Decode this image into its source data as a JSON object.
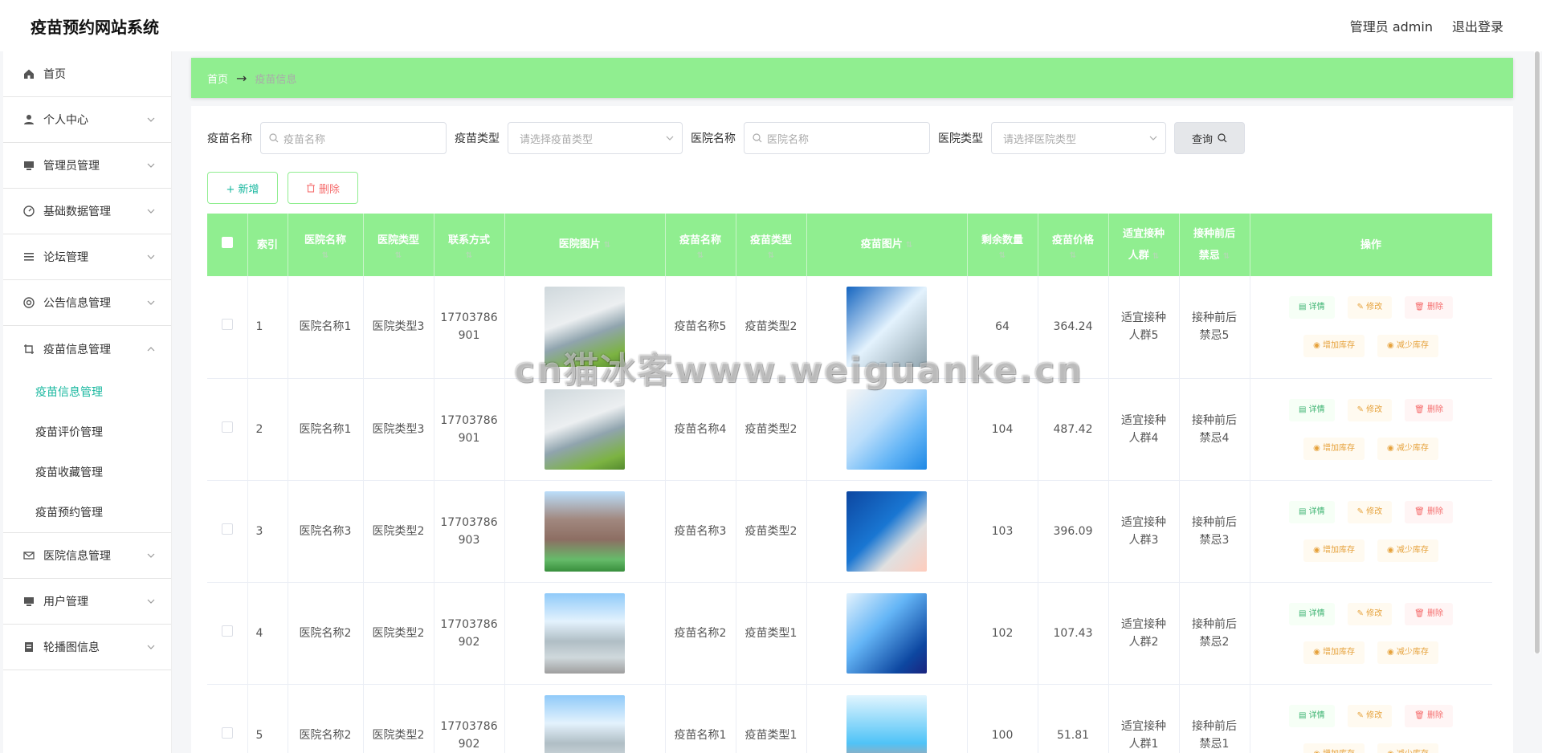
{
  "app": {
    "title": "疫苗预约网站系统",
    "user": "管理员 admin",
    "logout": "退出登录"
  },
  "sidebar": {
    "items": [
      {
        "label": "首页",
        "icon": "home-icon"
      },
      {
        "label": "个人中心",
        "icon": "user-icon"
      },
      {
        "label": "管理员管理",
        "icon": "monitor-icon"
      },
      {
        "label": "基础数据管理",
        "icon": "gauge-icon"
      },
      {
        "label": "论坛管理",
        "icon": "list-icon"
      },
      {
        "label": "公告信息管理",
        "icon": "lifebuoy-icon"
      },
      {
        "label": "疫苗信息管理",
        "icon": "crop-icon"
      },
      {
        "label": "医院信息管理",
        "icon": "mail-icon"
      },
      {
        "label": "用户管理",
        "icon": "monitor-icon"
      },
      {
        "label": "轮播图信息",
        "icon": "notebook-icon"
      }
    ],
    "submenu": [
      "疫苗信息管理",
      "疫苗评价管理",
      "疫苗收藏管理",
      "疫苗预约管理"
    ]
  },
  "breadcrumb": {
    "home": "首页",
    "arrow": "→",
    "current": "疫苗信息"
  },
  "search": {
    "vaccine_name_label": "疫苗名称",
    "vaccine_name_placeholder": "疫苗名称",
    "vaccine_type_label": "疫苗类型",
    "vaccine_type_placeholder": "请选择疫苗类型",
    "hospital_name_label": "医院名称",
    "hospital_name_placeholder": "医院名称",
    "hospital_type_label": "医院类型",
    "hospital_type_placeholder": "请选择医院类型",
    "query_label": "查询"
  },
  "actions": {
    "add": "+ 新增",
    "delete": "删除"
  },
  "table": {
    "headers": {
      "index": "索引",
      "hospital_name": "医院名称",
      "hospital_type": "医院类型",
      "contact": "联系方式",
      "hospital_image": "医院图片",
      "vaccine_name": "疫苗名称",
      "vaccine_type": "疫苗类型",
      "vaccine_image": "疫苗图片",
      "remaining": "剩余数量",
      "price": "疫苗价格",
      "suitable_l1": "适宜接种",
      "suitable_l2": "人群",
      "taboo_l1": "接种前后",
      "taboo_l2": "禁忌",
      "ops": "操作",
      "sort_icon": "⇅"
    },
    "op_labels": {
      "detail": "详情",
      "edit": "修改",
      "delete": "删除",
      "add_stock": "增加库存",
      "reduce_stock": "减少库存"
    },
    "rows": [
      {
        "index": "1",
        "hospital_name": "医院名称1",
        "hospital_type": "医院类型3",
        "contact_l1": "17703786",
        "contact_l2": "901",
        "vaccine_name": "疫苗名称5",
        "vaccine_type": "疫苗类型2",
        "remaining": "64",
        "price": "364.24",
        "suitable_l1": "适宜接种",
        "suitable_l2": "人群5",
        "taboo_l1": "接种前后",
        "taboo_l2": "禁忌5"
      },
      {
        "index": "2",
        "hospital_name": "医院名称1",
        "hospital_type": "医院类型3",
        "contact_l1": "17703786",
        "contact_l2": "901",
        "vaccine_name": "疫苗名称4",
        "vaccine_type": "疫苗类型2",
        "remaining": "104",
        "price": "487.42",
        "suitable_l1": "适宜接种",
        "suitable_l2": "人群4",
        "taboo_l1": "接种前后",
        "taboo_l2": "禁忌4"
      },
      {
        "index": "3",
        "hospital_name": "医院名称3",
        "hospital_type": "医院类型2",
        "contact_l1": "17703786",
        "contact_l2": "903",
        "vaccine_name": "疫苗名称3",
        "vaccine_type": "疫苗类型2",
        "remaining": "103",
        "price": "396.09",
        "suitable_l1": "适宜接种",
        "suitable_l2": "人群3",
        "taboo_l1": "接种前后",
        "taboo_l2": "禁忌3"
      },
      {
        "index": "4",
        "hospital_name": "医院名称2",
        "hospital_type": "医院类型2",
        "contact_l1": "17703786",
        "contact_l2": "902",
        "vaccine_name": "疫苗名称2",
        "vaccine_type": "疫苗类型1",
        "remaining": "102",
        "price": "107.43",
        "suitable_l1": "适宜接种",
        "suitable_l2": "人群2",
        "taboo_l1": "接种前后",
        "taboo_l2": "禁忌2"
      },
      {
        "index": "5",
        "hospital_name": "医院名称2",
        "hospital_type": "医院类型2",
        "contact_l1": "17703786",
        "contact_l2": "902",
        "vaccine_name": "疫苗名称1",
        "vaccine_type": "疫苗类型1",
        "remaining": "100",
        "price": "51.81",
        "suitable_l1": "适宜接种",
        "suitable_l2": "人群1",
        "taboo_l1": "接种前后",
        "taboo_l2": "禁忌1"
      }
    ]
  },
  "watermark": "cn猫冰客www.weiguanke.cn",
  "colors": {
    "accent": "#90ee90",
    "active_text": "#1bb8a0",
    "danger": "#f56c6c",
    "warning": "#e6a23c"
  }
}
